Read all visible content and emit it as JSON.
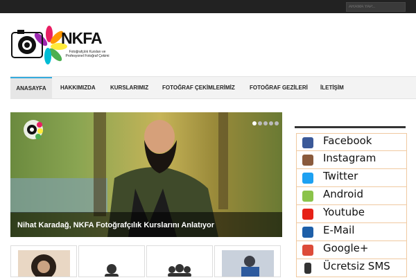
{
  "search": {
    "placeholder": "ARAMA YAP..."
  },
  "logo": {
    "text": "NKFA",
    "subtitle": "Fotoğrafçılık Kursları ve Profesyonel Fotoğraf Çekimi"
  },
  "nav": [
    {
      "label": "ANASAYFA"
    },
    {
      "label": "HAKKIMIZDA"
    },
    {
      "label": "KURSLARIMIZ"
    },
    {
      "label": "FOTOĞRAF ÇEKİMLERİMİZ"
    },
    {
      "label": "FOTOĞRAF GEZİLERİ"
    },
    {
      "label": "İLETİŞİM"
    }
  ],
  "slider": {
    "caption": "Nihat Karadağ, NKFA Fotoğrafçılık Kurslarını Anlatıyor"
  },
  "social": [
    {
      "label": "Facebook",
      "icon": "facebook-icon",
      "color": "#3b5998"
    },
    {
      "label": "Instagram",
      "icon": "instagram-icon",
      "color": "#8a5a3c"
    },
    {
      "label": "Twitter",
      "icon": "twitter-icon",
      "color": "#1da1f2"
    },
    {
      "label": "Android",
      "icon": "android-icon",
      "color": "#8bc34a"
    },
    {
      "label": "Youtube",
      "icon": "youtube-icon",
      "color": "#e62117"
    },
    {
      "label": "E-Mail",
      "icon": "email-icon",
      "color": "#1e5fa8"
    },
    {
      "label": "Google+",
      "icon": "google-plus-icon",
      "color": "#dd4b39"
    },
    {
      "label": "Ücretsiz SMS",
      "icon": "phone-icon",
      "color": "#333333"
    }
  ]
}
